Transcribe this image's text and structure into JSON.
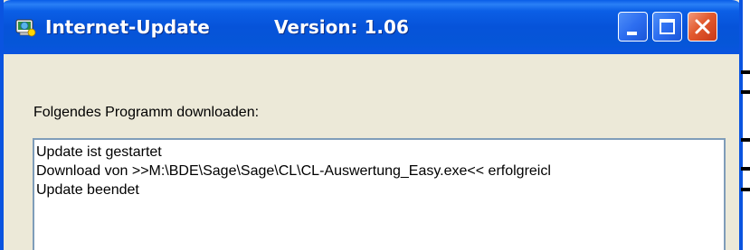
{
  "window": {
    "title": "Internet-Update",
    "version_label": "Version: 1.06",
    "icon": "update-globe-icon",
    "controls": {
      "minimize": "minimize-icon",
      "maximize": "maximize-icon",
      "close": "close-icon"
    }
  },
  "content": {
    "label": "Folgendes Programm downloaden:",
    "log_lines": [
      "Update ist gestartet",
      "Download von >>M:\\BDE\\Sage\\Sage\\CL\\CL-Auswertung_Easy.exe<< erfolgreicl",
      "Update beendet"
    ]
  },
  "colors": {
    "titlebar": "#0a54e0",
    "window_bg": "#ece9d8",
    "close_button": "#e25a2e",
    "textbox_border": "#7f9db9"
  }
}
